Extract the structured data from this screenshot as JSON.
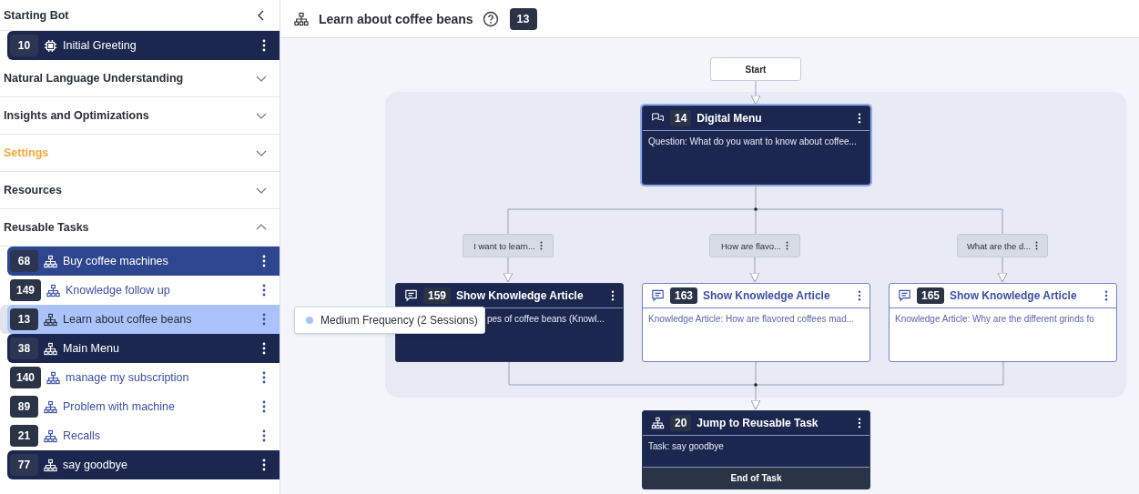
{
  "sidebar": {
    "title": "Starting Bot",
    "start_items": [
      {
        "id": "10",
        "label": "Initial Greeting",
        "kind": "chip",
        "color": "#1c2750",
        "selected": false
      }
    ],
    "sections": [
      {
        "title": "Natural Language Understanding",
        "expanded": false,
        "active": false
      },
      {
        "title": "Insights and Optimizations",
        "expanded": false,
        "active": false
      },
      {
        "title": "Settings",
        "expanded": false,
        "active": true
      },
      {
        "title": "Resources",
        "expanded": false,
        "active": false
      },
      {
        "title": "Reusable Tasks",
        "expanded": true,
        "active": false,
        "items": [
          {
            "id": "68",
            "label": "Buy coffee machines",
            "kind": "task",
            "color": "#2e468f",
            "selected": false
          },
          {
            "id": "149",
            "label": "Knowledge follow up",
            "kind": "task",
            "color": "#ffffff",
            "selected": false
          },
          {
            "id": "13",
            "label": "Learn about coffee beans",
            "kind": "task",
            "color": "#aac4fb",
            "selected": true
          },
          {
            "id": "38",
            "label": "Main Menu",
            "kind": "task",
            "color": "#1c2750",
            "selected": false
          },
          {
            "id": "140",
            "label": "manage my subscription",
            "kind": "task",
            "color": "#ffffff",
            "selected": false
          },
          {
            "id": "89",
            "label": "Problem with machine",
            "kind": "task",
            "color": "#ffffff",
            "selected": false
          },
          {
            "id": "21",
            "label": "Recalls",
            "kind": "task",
            "color": "#ffffff",
            "selected": false
          },
          {
            "id": "77",
            "label": "say goodbye",
            "kind": "task",
            "color": "#1c2750",
            "selected": false
          }
        ]
      }
    ]
  },
  "header": {
    "title": "Learn about coffee beans",
    "badge": "13"
  },
  "flow": {
    "start": "Start",
    "menu": {
      "kind": "menu",
      "id": "14",
      "title": "Digital Menu",
      "text": "Question: What do you want to know about coffee...",
      "color": "#1c2750",
      "highlighted": true
    },
    "branches": [
      {
        "condition": "I want to learn...",
        "node": {
          "kind": "article",
          "id": "159",
          "title": "Show Knowledge Article",
          "text": "pes of coffee beans (Knowl...",
          "color": "#1c2750",
          "highlighted": false
        }
      },
      {
        "condition": "How are flavo...",
        "node": {
          "kind": "article",
          "id": "163",
          "title": "Show Knowledge Article",
          "text": "Knowledge Article: How are flavored coffees mad...",
          "color": "#ffffff",
          "highlighted": false
        }
      },
      {
        "condition": "What are the d...",
        "node": {
          "kind": "article",
          "id": "165",
          "title": "Show Knowledge Article",
          "text": "Knowledge Article: Why are the different grinds fo",
          "color": "#ffffff",
          "highlighted": false
        }
      }
    ],
    "end": {
      "kind": "jump",
      "id": "20",
      "title": "Jump to Reusable Task",
      "text": "Task: say goodbye",
      "color": "#1c2750",
      "highlighted": false,
      "footer": "End of Task"
    },
    "tooltip": "Medium Frequency (2 Sessions)"
  }
}
